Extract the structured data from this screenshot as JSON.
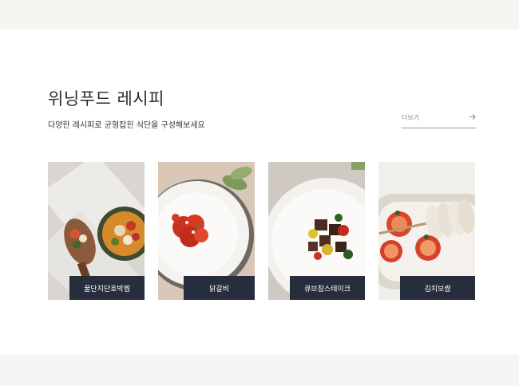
{
  "section": {
    "title": "위닝푸드 레시피",
    "subtitle": "다양한 레시피로 균형잡힌 식단을 구성해보세요",
    "more_label": "더보기",
    "more_icon": "arrow-right-icon"
  },
  "recipes": [
    {
      "label": "꿀단지단호박찜"
    },
    {
      "label": "닭갈비"
    },
    {
      "label": "큐브참스테이크"
    },
    {
      "label": "김치보쌈"
    }
  ],
  "colors": {
    "top_band": "#f6f5f1",
    "bottom_band": "#f6f5f3",
    "label_bg": "#262d3d"
  }
}
